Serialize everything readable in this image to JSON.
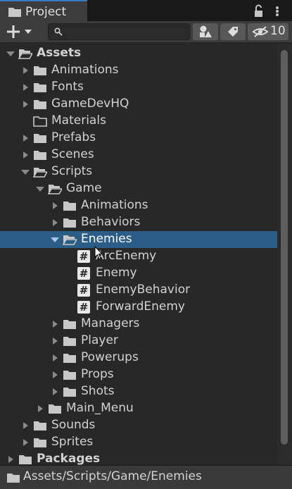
{
  "tab": {
    "title": "Project"
  },
  "toolbar": {
    "hidden_count": "10"
  },
  "tree": [
    {
      "label": "Assets",
      "level": 0,
      "kind": "folder",
      "state": "open",
      "bold": true
    },
    {
      "label": "Animations",
      "level": 1,
      "kind": "folder",
      "state": "closed"
    },
    {
      "label": "Fonts",
      "level": 1,
      "kind": "folder",
      "state": "closed"
    },
    {
      "label": "GameDevHQ",
      "level": 1,
      "kind": "folder",
      "state": "closed"
    },
    {
      "label": "Materials",
      "level": 1,
      "kind": "folder-empty",
      "state": "none"
    },
    {
      "label": "Prefabs",
      "level": 1,
      "kind": "folder",
      "state": "closed"
    },
    {
      "label": "Scenes",
      "level": 1,
      "kind": "folder",
      "state": "closed"
    },
    {
      "label": "Scripts",
      "level": 1,
      "kind": "folder",
      "state": "open"
    },
    {
      "label": "Game",
      "level": 2,
      "kind": "folder",
      "state": "open"
    },
    {
      "label": "Animations",
      "level": 3,
      "kind": "folder",
      "state": "closed"
    },
    {
      "label": "Behaviors",
      "level": 3,
      "kind": "folder",
      "state": "closed"
    },
    {
      "label": "Enemies",
      "level": 3,
      "kind": "folder",
      "state": "open",
      "selected": true
    },
    {
      "label": "ArcEnemy",
      "level": 4,
      "kind": "script",
      "state": "none"
    },
    {
      "label": "Enemy",
      "level": 4,
      "kind": "script",
      "state": "none"
    },
    {
      "label": "EnemyBehavior",
      "level": 4,
      "kind": "script",
      "state": "none"
    },
    {
      "label": "ForwardEnemy",
      "level": 4,
      "kind": "script",
      "state": "none"
    },
    {
      "label": "Managers",
      "level": 3,
      "kind": "folder",
      "state": "closed"
    },
    {
      "label": "Player",
      "level": 3,
      "kind": "folder",
      "state": "closed"
    },
    {
      "label": "Powerups",
      "level": 3,
      "kind": "folder",
      "state": "closed"
    },
    {
      "label": "Props",
      "level": 3,
      "kind": "folder",
      "state": "closed"
    },
    {
      "label": "Shots",
      "level": 3,
      "kind": "folder",
      "state": "closed"
    },
    {
      "label": "Main_Menu",
      "level": 2,
      "kind": "folder",
      "state": "closed"
    },
    {
      "label": "Sounds",
      "level": 1,
      "kind": "folder",
      "state": "closed"
    },
    {
      "label": "Sprites",
      "level": 1,
      "kind": "folder",
      "state": "closed"
    },
    {
      "label": "Packages",
      "level": 0,
      "kind": "folder",
      "state": "closed",
      "bold": true
    }
  ],
  "status": {
    "path": "Assets/Scripts/Game/Enemies"
  },
  "colors": {
    "selection": "#2c5d87",
    "background": "#282828",
    "accent": "#3a79bb"
  }
}
